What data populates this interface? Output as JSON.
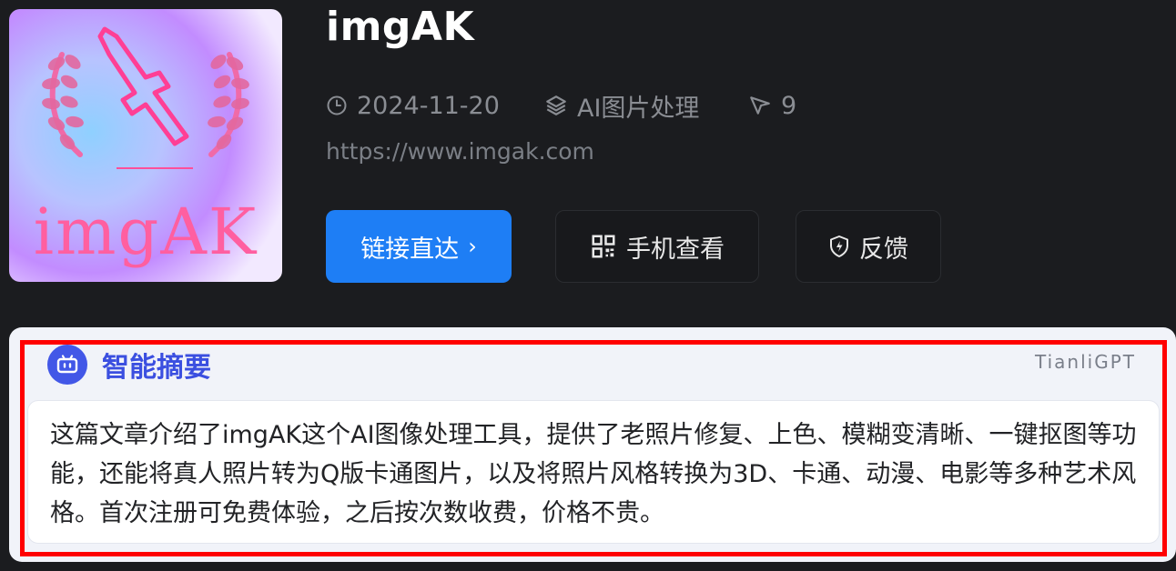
{
  "app": {
    "name": "imgAK",
    "logo_text": "imgAK",
    "date": "2024-11-20",
    "category": "AI图片处理",
    "views": "9",
    "url": "https://www.imgak.com"
  },
  "actions": {
    "visit_label": "链接直达",
    "mobile_label": "手机查看",
    "feedback_label": "反馈"
  },
  "summary": {
    "title": "智能摘要",
    "brand": "TianliGPT",
    "text": "这篇文章介绍了imgAK这个AI图像处理工具，提供了老照片修复、上色、模糊变清晰、一键抠图等功能，还能将真人照片转为Q版卡通图片，以及将照片风格转换为3D、卡通、动漫、电影等多种艺术风格。首次注册可免费体验，之后按次数收费，价格不贵。"
  },
  "colors": {
    "background": "#1b1c1f",
    "primary": "#1e7ef5",
    "summary_accent": "#3b4fe0",
    "highlight": "#ff0000"
  },
  "icons": {
    "date": "clock-icon",
    "category": "layers-icon",
    "views": "cursor-arrow-icon",
    "mobile": "qr-code-icon",
    "feedback": "shield-icon",
    "summary": "robot-icon"
  }
}
